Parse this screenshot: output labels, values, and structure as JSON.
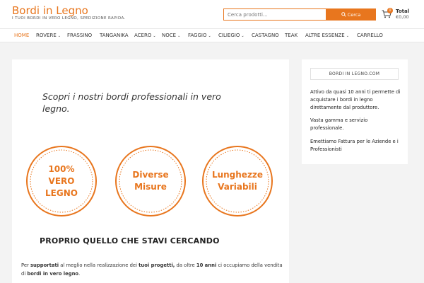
{
  "header": {
    "site_title": "Bordi in Legno",
    "tagline": "I TUOI BORDI IN VERO LEGNO, SPEDIZIONE RAPIDA.",
    "search": {
      "placeholder": "Cerca prodotti...",
      "button_label": "Cerca"
    },
    "cart": {
      "count": "0",
      "label": "Total",
      "value": "€0,00"
    }
  },
  "nav": {
    "items": [
      {
        "label": "HOME",
        "dropdown": false,
        "active": true
      },
      {
        "label": "ROVERE",
        "dropdown": true
      },
      {
        "label": "FRASSINO",
        "dropdown": false
      },
      {
        "label": "TANGANIKA",
        "dropdown": false
      },
      {
        "label": "ACERO",
        "dropdown": true
      },
      {
        "label": "NOCE",
        "dropdown": true
      },
      {
        "label": "FAGGIO",
        "dropdown": true
      },
      {
        "label": "CILIEGIO",
        "dropdown": true
      },
      {
        "label": "CASTAGNO",
        "dropdown": false
      },
      {
        "label": "TEAK",
        "dropdown": false
      },
      {
        "label": "ALTRE ESSENZE",
        "dropdown": true
      },
      {
        "label": "CARRELLO",
        "dropdown": false
      }
    ],
    "caret": "⌄"
  },
  "main": {
    "intro": "Scopri i nostri bordi professionali in vero legno.",
    "badges": [
      {
        "lines": [
          "100%",
          "VERO",
          "LEGNO"
        ]
      },
      {
        "lines": [
          "Diverse",
          "Misure"
        ]
      },
      {
        "lines": [
          "Lunghezze",
          "Variabili"
        ]
      }
    ],
    "heading": "PROPRIO QUELLO CHE STAVI CERCANDO",
    "paragraph": {
      "p1": "Per ",
      "b1": "supportati",
      "p2": " al meglio nella realizzazione dei ",
      "b2": "tuoi progetti,",
      "p3": " da oltre ",
      "b3": "10 anni",
      "p4": " ci occupiamo della vendita di ",
      "b4": "bordi in vero legno",
      "p5": "."
    }
  },
  "sidebar": {
    "title": "BORDI IN LEGNO.COM",
    "p1": "Attivo da quasi 10 anni ti permette di acquistare i bordi in legno direttamente dal produttore.",
    "p2": "Vasta gamma e servizio professionale.",
    "p3": "Emettiamo Fattura per le Aziende e i Professionisti"
  },
  "colors": {
    "accent": "#e8761e",
    "page_bg": "#f3f3f3"
  }
}
